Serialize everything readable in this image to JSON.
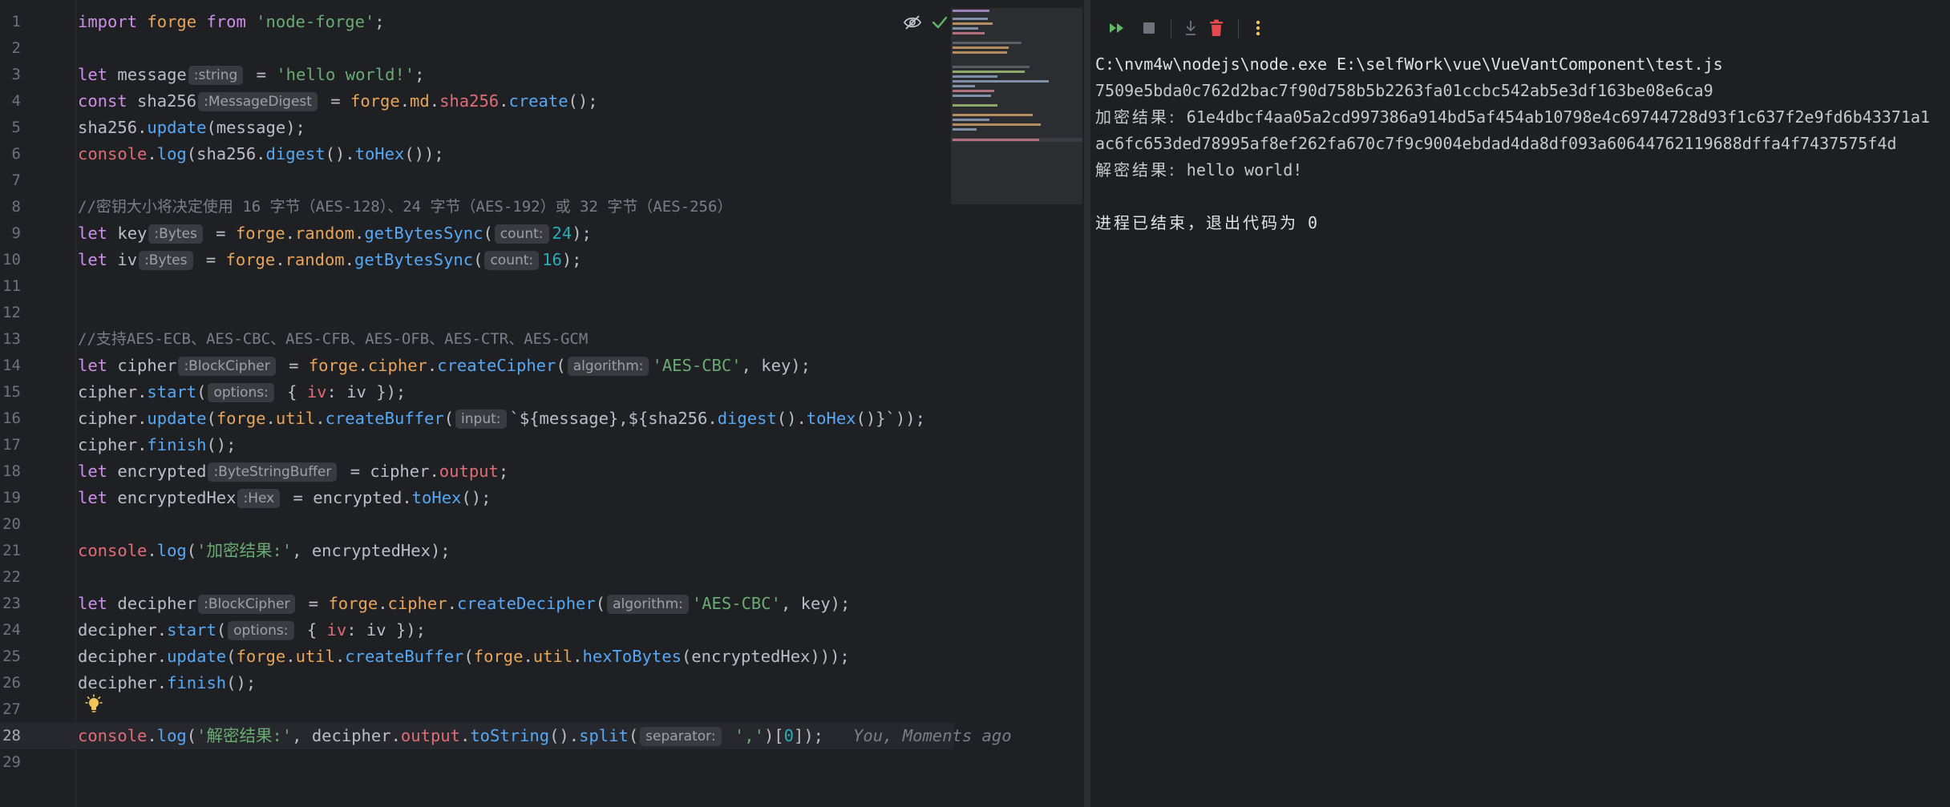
{
  "editor": {
    "line_numbers": [
      "1",
      "2",
      "3",
      "4",
      "5",
      "6",
      "7",
      "8",
      "9",
      "10",
      "11",
      "12",
      "13",
      "14",
      "15",
      "16",
      "17",
      "18",
      "19",
      "20",
      "21",
      "22",
      "23",
      "24",
      "25",
      "26",
      "27",
      "28",
      "29"
    ],
    "l1": {
      "kw_import": "import",
      "id_forge": " forge ",
      "kw_from": "from",
      "str_module": " 'node-forge'",
      "semi": ";"
    },
    "l3": {
      "kw": "let",
      "name": " message",
      "hint": ":string",
      "eq": " = ",
      "str": "'hello world!'",
      "semi": ";"
    },
    "l4": {
      "kw": "const",
      "name": " sha256",
      "hint": ":MessageDigest",
      "eq": " = ",
      "obj": "forge",
      "dot1": ".",
      "md": "md",
      "dot2": ".",
      "sha": "sha256",
      "dot3": ".",
      "fn": "create",
      "end": "();"
    },
    "l5": {
      "obj": "sha256",
      "dot": ".",
      "fn": "update",
      "end": "(message);"
    },
    "l6": {
      "console": "console",
      "dot1": ".",
      "log": "log",
      "open": "(sha256.",
      "digest": "digest",
      "mid": "().",
      "tohex": "toHex",
      "end": "());"
    },
    "l8": {
      "comment": "//密钥大小将决定使用 16 字节（AES-128）、24 字节（AES-192）或 32 字节（AES-256）"
    },
    "l9": {
      "kw": "let",
      "name": " key",
      "hint": ":Bytes",
      "eq": " = ",
      "obj": "forge",
      "dot1": ".",
      "random": "random",
      "dot2": ".",
      "fn": "getBytesSync",
      "open": "(",
      "param_hint": "count:",
      "num": "24",
      "end": ");"
    },
    "l10": {
      "kw": "let",
      "name": " iv",
      "hint": ":Bytes",
      "eq": " = ",
      "obj": "forge",
      "dot1": ".",
      "random": "random",
      "dot2": ".",
      "fn": "getBytesSync",
      "open": "(",
      "param_hint": "count:",
      "num": "16",
      "end": ");"
    },
    "l13": {
      "comment": "//支持AES-ECB、AES-CBC、AES-CFB、AES-OFB、AES-CTR、AES-GCM"
    },
    "l14": {
      "kw": "let",
      "name": " cipher",
      "hint": ":BlockCipher",
      "eq": " = ",
      "obj": "forge",
      "dot1": ".",
      "cipher": "cipher",
      "dot2": ".",
      "fn": "createCipher",
      "open": "(",
      "param_hint": "algorithm:",
      "str": "'AES-CBC'",
      "end": ", key);"
    },
    "l15": {
      "name": "cipher",
      "dot": ".",
      "fn": "start",
      "open": "(",
      "param_hint": "options:",
      "brace": " { ",
      "prop": "iv",
      "end": ": iv });"
    },
    "l16": {
      "name": "cipher",
      "dot": ".",
      "fn": "update",
      "open": "(",
      "obj": "forge",
      "dot2": ".",
      "util": "util",
      "dot3": ".",
      "fn2": "createBuffer",
      "open2": "(",
      "param_hint": "input:",
      "tpl_start": "`${message},${sha256.",
      "digest": "digest",
      "mid": "().",
      "tohex": "toHex",
      "tpl_end": "()}`",
      "end": "));"
    },
    "l17": {
      "name": "cipher",
      "dot": ".",
      "fn": "finish",
      "end": "();"
    },
    "l18": {
      "kw": "let",
      "name": " encrypted",
      "hint": ":ByteStringBuffer",
      "eq": " = cipher.",
      "prop": "output",
      "semi": ";"
    },
    "l19": {
      "kw": "let",
      "name": " encryptedHex",
      "hint": ":Hex",
      "eq": " = encrypted.",
      "fn": "toHex",
      "end": "();"
    },
    "l21": {
      "console": "console",
      "dot1": ".",
      "log": "log",
      "open": "(",
      "str": "'加密结果:'",
      "end": ", encryptedHex);"
    },
    "l23": {
      "kw": "let",
      "name": " decipher",
      "hint": ":BlockCipher",
      "eq": " = ",
      "obj": "forge",
      "dot1": ".",
      "cipher": "cipher",
      "dot2": ".",
      "fn": "createDecipher",
      "open": "(",
      "param_hint": "algorithm:",
      "str": "'AES-CBC'",
      "end": ", key);"
    },
    "l24": {
      "name": "decipher",
      "dot": ".",
      "fn": "start",
      "open": "(",
      "param_hint": "options:",
      "brace": " { ",
      "prop": "iv",
      "end": ": iv });"
    },
    "l25": {
      "name": "decipher",
      "dot": ".",
      "fn": "update",
      "open": "(",
      "obj": "forge",
      "dot2": ".",
      "util": "util",
      "dot3": ".",
      "fn2": "createBuffer",
      "open2": "(",
      "obj2": "forge",
      "dot4": ".",
      "util2": "util",
      "dot5": ".",
      "fn3": "hexToBytes",
      "end": "(encryptedHex)));"
    },
    "l26": {
      "name": "decipher",
      "dot": ".",
      "fn": "finish",
      "end": "();"
    },
    "l28": {
      "console": "console",
      "dot1": ".",
      "log": "log",
      "open": "(",
      "str": "'解密结果:'",
      "mid": ", decipher.",
      "prop": "output",
      "dot2": ".",
      "fn": "toString",
      "dot3": "().",
      "fn2": "split",
      "open2": "(",
      "param_hint": "separator:",
      "str2": " ','",
      "idx_open": ")[",
      "num": "0",
      "end": "]);",
      "blame": "   You, Moments ago"
    }
  },
  "run_panel": {
    "toolbar": [
      "rerun-icon",
      "stop-icon",
      "scroll-to-end-icon",
      "clear-icon",
      "more-icon"
    ],
    "console": {
      "cmd": "C:\\nvm4w\\nodejs\\node.exe E:\\selfWork\\vue\\VueVantComponent\\test.js",
      "digest": "7509e5bda0c762d2bac7f90d758b5b2263fa01ccbc542ab5e3df163be08e6ca9",
      "enc_label": "加密结果:",
      "enc_value": " 61e4dbcf4aa05a2cd997386a914bd5af454ab10798e4c69744728d93f1c637f2e9fd6b43371a1",
      "enc_value_2": "ac6fc653ded78995af8ef262fa670c7f9c9004ebdad4da8df093a60644762119688dffa4f7437575f4d",
      "dec_label": "解密结果:",
      "dec_value": " hello world!",
      "exit_label": "进程已结束，退出代码为",
      "exit_code": " 0"
    }
  },
  "colors": {
    "keyword": "#cf8ee8",
    "string": "#6aab73",
    "function": "#56a8f5",
    "object": "#e8a45a",
    "property": "#e06c75",
    "number": "#2aacb8",
    "comment": "#7a7e85"
  }
}
